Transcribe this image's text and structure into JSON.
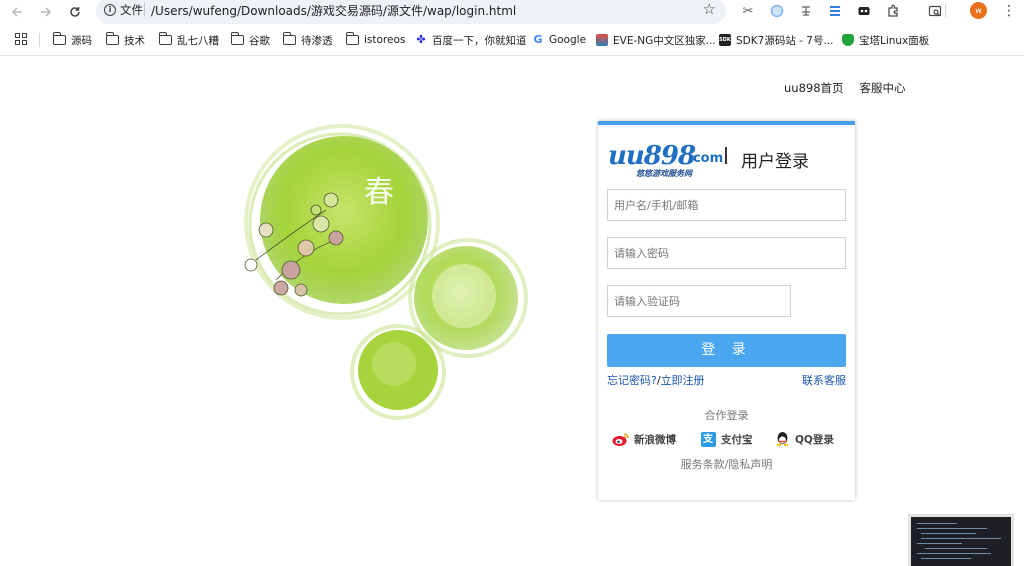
{
  "browser": {
    "scheme_label": "文件",
    "url": "/Users/wufeng/Downloads/游戏交易源码/源文件/wap/login.html",
    "avatar_letter": "w",
    "bookmarks": [
      {
        "label": "源码",
        "icon": "folder-icon"
      },
      {
        "label": "技术",
        "icon": "folder-icon"
      },
      {
        "label": "乱七八糟",
        "icon": "folder-icon"
      },
      {
        "label": "谷歌",
        "icon": "folder-icon"
      },
      {
        "label": "待渗透",
        "icon": "folder-icon"
      },
      {
        "label": "istoreos",
        "icon": "folder-icon"
      },
      {
        "label": "百度一下，你就知道",
        "icon": "baidu-icon",
        "color": "#2932e1"
      },
      {
        "label": "Google",
        "icon": "google-icon",
        "color": "#4285f4"
      },
      {
        "label": "EVE-NG中文区独家...",
        "icon": "eve-ng-icon",
        "color": "#d35400"
      },
      {
        "label": "SDK7源码站 - 7号...",
        "icon": "sdk7-icon",
        "color": "#222222"
      },
      {
        "label": "宝塔Linux面板",
        "icon": "baota-icon",
        "color": "#20a53a"
      }
    ]
  },
  "page": {
    "top_links": [
      "uu898首页",
      "客服中心"
    ],
    "art_character": "春",
    "login": {
      "logo_main": "uu898",
      "logo_com": ".com",
      "logo_sub": "悠悠游戏服务网",
      "title": "用户登录",
      "username_placeholder": "用户名/手机/邮箱",
      "password_placeholder": "请输入密码",
      "captcha_placeholder": "请输入验证码",
      "submit_label": "登 录",
      "forgot_label": "忘记密码?",
      "separator": "/",
      "register_label": "立即注册",
      "support_label": "联系客服",
      "coop_title": "合作登录",
      "social": [
        {
          "label": "新浪微博",
          "icon": "weibo-icon"
        },
        {
          "label": "支付宝",
          "icon": "alipay-icon",
          "glyph": "支"
        },
        {
          "label": "QQ登录",
          "icon": "qq-icon"
        }
      ],
      "terms_label": "服务条款/隐私声明"
    },
    "accent_color": "#45a0ec"
  }
}
